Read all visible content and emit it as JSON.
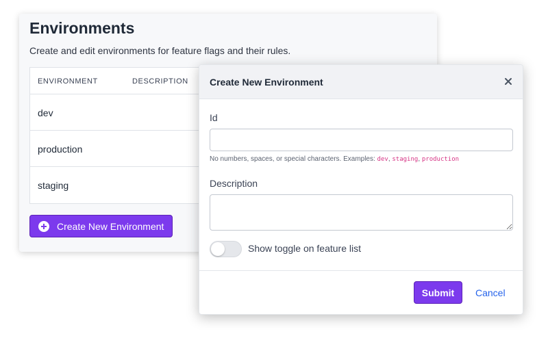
{
  "page": {
    "title": "Environments",
    "subtitle": "Create and edit environments for feature flags and their rules.",
    "table": {
      "columns": [
        "ENVIRONMENT",
        "DESCRIPTION"
      ],
      "rows": [
        {
          "id": "dev"
        },
        {
          "id": "production"
        },
        {
          "id": "staging"
        }
      ]
    },
    "create_button": {
      "label": "Create New Environment",
      "icon": "plus-circle-icon"
    }
  },
  "modal": {
    "title": "Create New Environment",
    "close_icon": "close-icon",
    "id_field": {
      "label": "Id",
      "value": "",
      "help_prefix": "No numbers, spaces, or special characters. Examples: ",
      "examples": [
        "dev",
        "staging",
        "production"
      ],
      "separator": ", "
    },
    "description_field": {
      "label": "Description",
      "value": ""
    },
    "toggle": {
      "label": "Show toggle on feature list",
      "on": false
    },
    "submit_label": "Submit",
    "cancel_label": "Cancel"
  },
  "colors": {
    "primary": "#7c3aed",
    "primary_border": "#5b21b6",
    "link": "#2563eb",
    "code": "#d63384"
  }
}
